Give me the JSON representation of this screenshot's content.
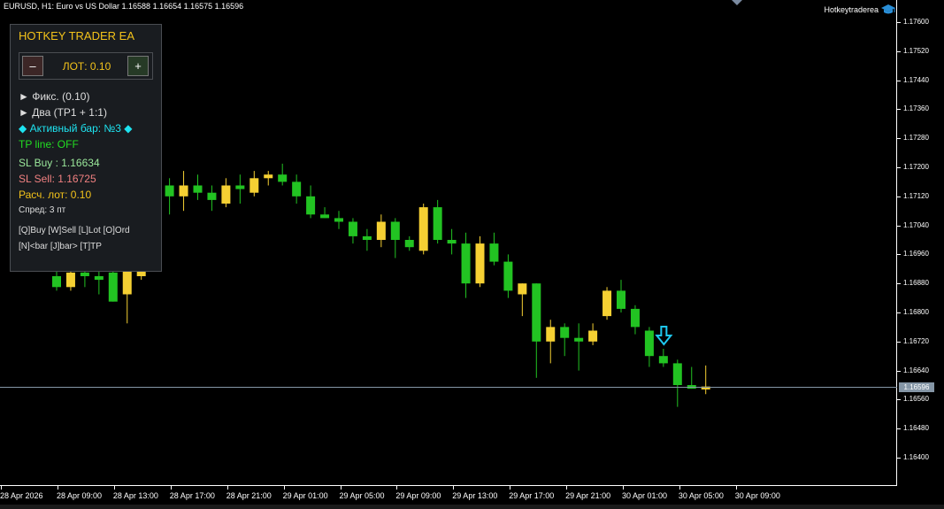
{
  "chart": {
    "title": "EURUSD, H1:  Euro vs US Dollar  1.16588 1.16654 1.16575 1.16596",
    "ea_name": "Hotkeytraderea",
    "bid_price": "1.16596",
    "price_labels": [
      "1.17600",
      "1.17520",
      "1.17440",
      "1.17360",
      "1.17280",
      "1.17200",
      "1.17120",
      "1.17040",
      "1.16960",
      "1.16880",
      "1.16800",
      "1.16720",
      "1.16640",
      "1.16560",
      "1.16480",
      "1.16400"
    ],
    "time_labels": [
      "28 Apr 2026",
      "28 Apr 09:00",
      "28 Apr 13:00",
      "28 Apr 17:00",
      "28 Apr 21:00",
      "29 Apr 01:00",
      "29 Apr 05:00",
      "29 Apr 09:00",
      "29 Apr 13:00",
      "29 Apr 17:00",
      "29 Apr 21:00",
      "30 Apr 01:00",
      "30 Apr 05:00",
      "30 Apr 09:00"
    ],
    "colors": {
      "bull": "#f5d033",
      "bear": "#22c322",
      "bid_line": "#8596a6",
      "background": "#000000",
      "marker": "#1ec8f0"
    }
  },
  "chart_data": {
    "type": "candlestick",
    "symbol": "EURUSD",
    "timeframe": "H1",
    "ylim": [
      1.1636,
      1.1765
    ],
    "candles": [
      {
        "o": 1.169,
        "h": 1.1695,
        "l": 1.1686,
        "c": 1.1687
      },
      {
        "o": 1.1687,
        "h": 1.1696,
        "l": 1.1686,
        "c": 1.1691
      },
      {
        "o": 1.1691,
        "h": 1.1695,
        "l": 1.1687,
        "c": 1.169
      },
      {
        "o": 1.169,
        "h": 1.1696,
        "l": 1.1685,
        "c": 1.1689
      },
      {
        "o": 1.1691,
        "h": 1.1693,
        "l": 1.1683,
        "c": 1.1683
      },
      {
        "o": 1.1685,
        "h": 1.1695,
        "l": 1.1677,
        "c": 1.1692
      },
      {
        "o": 1.169,
        "h": 1.1696,
        "l": 1.1689,
        "c": 1.1695
      },
      {
        "o": 1.1695,
        "h": 1.1715,
        "l": 1.1693,
        "c": 1.1715
      },
      {
        "o": 1.1715,
        "h": 1.1717,
        "l": 1.1707,
        "c": 1.1712
      },
      {
        "o": 1.1712,
        "h": 1.1719,
        "l": 1.1708,
        "c": 1.1715
      },
      {
        "o": 1.1715,
        "h": 1.1718,
        "l": 1.1711,
        "c": 1.1713
      },
      {
        "o": 1.1713,
        "h": 1.1715,
        "l": 1.1708,
        "c": 1.1711
      },
      {
        "o": 1.171,
        "h": 1.1717,
        "l": 1.1709,
        "c": 1.1715
      },
      {
        "o": 1.1715,
        "h": 1.1718,
        "l": 1.171,
        "c": 1.1714
      },
      {
        "o": 1.1713,
        "h": 1.1719,
        "l": 1.1712,
        "c": 1.1717
      },
      {
        "o": 1.1717,
        "h": 1.1719,
        "l": 1.1715,
        "c": 1.1718
      },
      {
        "o": 1.1718,
        "h": 1.1721,
        "l": 1.1715,
        "c": 1.1716
      },
      {
        "o": 1.1716,
        "h": 1.1718,
        "l": 1.171,
        "c": 1.1712
      },
      {
        "o": 1.1712,
        "h": 1.1715,
        "l": 1.1706,
        "c": 1.1707
      },
      {
        "o": 1.1707,
        "h": 1.1709,
        "l": 1.1706,
        "c": 1.1706
      },
      {
        "o": 1.1706,
        "h": 1.1708,
        "l": 1.1703,
        "c": 1.1705
      },
      {
        "o": 1.1705,
        "h": 1.1706,
        "l": 1.1699,
        "c": 1.1701
      },
      {
        "o": 1.1701,
        "h": 1.1703,
        "l": 1.1697,
        "c": 1.17
      },
      {
        "o": 1.17,
        "h": 1.1707,
        "l": 1.1698,
        "c": 1.1705
      },
      {
        "o": 1.1705,
        "h": 1.1706,
        "l": 1.1695,
        "c": 1.17
      },
      {
        "o": 1.17,
        "h": 1.1701,
        "l": 1.1697,
        "c": 1.1698
      },
      {
        "o": 1.1697,
        "h": 1.171,
        "l": 1.1696,
        "c": 1.1709
      },
      {
        "o": 1.1709,
        "h": 1.1711,
        "l": 1.1699,
        "c": 1.17
      },
      {
        "o": 1.17,
        "h": 1.1703,
        "l": 1.1696,
        "c": 1.1699
      },
      {
        "o": 1.1699,
        "h": 1.1702,
        "l": 1.1684,
        "c": 1.1688
      },
      {
        "o": 1.1688,
        "h": 1.1701,
        "l": 1.1687,
        "c": 1.1699
      },
      {
        "o": 1.1699,
        "h": 1.1702,
        "l": 1.1693,
        "c": 1.1694
      },
      {
        "o": 1.1694,
        "h": 1.1696,
        "l": 1.1684,
        "c": 1.1686
      },
      {
        "o": 1.1685,
        "h": 1.1688,
        "l": 1.1679,
        "c": 1.1688
      },
      {
        "o": 1.1688,
        "h": 1.1688,
        "l": 1.1662,
        "c": 1.1672
      },
      {
        "o": 1.1672,
        "h": 1.1678,
        "l": 1.1666,
        "c": 1.1676
      },
      {
        "o": 1.1676,
        "h": 1.1677,
        "l": 1.1668,
        "c": 1.1673
      },
      {
        "o": 1.1673,
        "h": 1.1677,
        "l": 1.1664,
        "c": 1.1672
      },
      {
        "o": 1.1672,
        "h": 1.1677,
        "l": 1.1671,
        "c": 1.1675
      },
      {
        "o": 1.1679,
        "h": 1.1687,
        "l": 1.1678,
        "c": 1.1686
      },
      {
        "o": 1.1686,
        "h": 1.1689,
        "l": 1.168,
        "c": 1.1681
      },
      {
        "o": 1.1681,
        "h": 1.1682,
        "l": 1.1674,
        "c": 1.1676
      },
      {
        "o": 1.1675,
        "h": 1.1676,
        "l": 1.1665,
        "c": 1.1668
      },
      {
        "o": 1.1668,
        "h": 1.167,
        "l": 1.1665,
        "c": 1.1666
      },
      {
        "o": 1.1666,
        "h": 1.1667,
        "l": 1.1654,
        "c": 1.166
      },
      {
        "o": 1.166,
        "h": 1.1665,
        "l": 1.1659,
        "c": 1.1659
      },
      {
        "o": 1.16588,
        "h": 1.16654,
        "l": 1.16575,
        "c": 1.16596
      }
    ]
  },
  "panel": {
    "title": "HOTKEY TRADER EA",
    "lot_minus": "–",
    "lot_plus": "+",
    "lot_value": "ЛОТ: 0.10",
    "rows": [
      {
        "text": "► Фикс. (0.10)",
        "color": "#dddddd",
        "size": 12
      },
      {
        "text": "► Два (TP1 + 1:1)",
        "color": "#dddddd",
        "size": 12
      },
      {
        "text": "◆ Активный бар: №3 ◆",
        "color": "#1ee3f0",
        "size": 12
      },
      {
        "text": "TP line: OFF",
        "color": "#22dd22",
        "size": 12
      },
      {
        "text": "SL Buy : 1.16634",
        "color": "#9be89b",
        "size": 12
      },
      {
        "text": "SL Sell: 1.16725",
        "color": "#f08080",
        "size": 12
      },
      {
        "text": "Расч. лот: 0.10",
        "color": "#f2c21a",
        "size": 12
      },
      {
        "text": "Спред: 3 пт",
        "color": "#dddddd",
        "size": 10
      },
      {
        "text": "[Q]Buy  [W]Sell  [L]Lot  [O]Ord",
        "color": "#dddddd",
        "size": 10
      },
      {
        "text": "[N]<bar  [J]bar>  [T]TP",
        "color": "#dddddd",
        "size": 10
      }
    ]
  }
}
